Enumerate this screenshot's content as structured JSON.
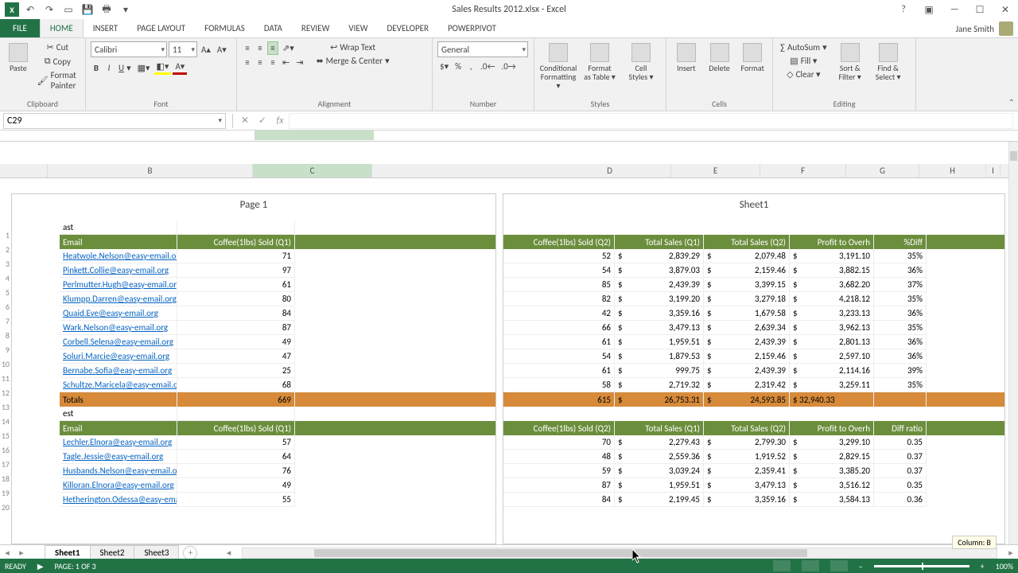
{
  "window": {
    "title": "Sales Results 2012.xlsx - Excel",
    "user": "Jane Smith"
  },
  "tabs": [
    "HOME",
    "INSERT",
    "PAGE LAYOUT",
    "FORMULAS",
    "DATA",
    "REVIEW",
    "VIEW",
    "DEVELOPER",
    "POWERPIVOT"
  ],
  "file_tab": "FILE",
  "ribbon": {
    "clipboard": {
      "paste": "Paste",
      "cut": "Cut",
      "copy": "Copy",
      "fmt": "Format Painter",
      "label": "Clipboard"
    },
    "font": {
      "name": "Calibri",
      "size": "11",
      "label": "Font"
    },
    "alignment": {
      "wrap": "Wrap Text",
      "merge": "Merge & Center",
      "label": "Alignment"
    },
    "number": {
      "format": "General",
      "label": "Number"
    },
    "styles": {
      "cond": "Conditional Formatting ▾",
      "table": "Format as Table ▾",
      "cell": "Cell Styles ▾",
      "label": "Styles"
    },
    "cells": {
      "insert": "Insert",
      "delete": "Delete",
      "format": "Format",
      "label": "Cells"
    },
    "editing": {
      "sum": "AutoSum",
      "fill": "Fill ▾",
      "clear": "Clear ▾",
      "sort": "Sort & Filter ▾",
      "find": "Find & Select ▾",
      "label": "Editing"
    }
  },
  "namebox": "C29",
  "columns_left": {
    "B": "B",
    "C": "C"
  },
  "columns_right": {
    "D": "D",
    "E": "E",
    "F": "F",
    "G": "G",
    "H": "H",
    "I": "I"
  },
  "pages": {
    "left_title": "Page 1",
    "right_title": "Sheet1"
  },
  "hdr1": {
    "frag": "ast",
    "email": "Email",
    "q1": "Coffee(1lbs) Sold (Q1)",
    "q2": "Coffee(1lbs) Sold (Q2)",
    "e": "Total Sales (Q1)",
    "f": "Total Sales (Q2)",
    "g": "Profit to Overh",
    "h": "%Diff"
  },
  "hdr2": {
    "frag": "est",
    "email": "Email",
    "q1": "Coffee(1lbs) Sold (Q1)",
    "q2": "Coffee(1lbs) Sold (Q2)",
    "e": "Total Sales (Q1)",
    "f": "Total Sales (Q2)",
    "g": "Profit to Overh",
    "h": "Diff ratio"
  },
  "block1": [
    {
      "email": "Heatwole.Nelson@easy-email.org",
      "q1": "71",
      "q2": "52",
      "e": "2,839.29",
      "f": "2,079.48",
      "g": "3,191.10",
      "h": "35%"
    },
    {
      "email": "Pinkett.Collie@easy-email.org",
      "q1": "97",
      "q2": "54",
      "e": "3,879.03",
      "f": "2,159.46",
      "g": "3,882.15",
      "h": "36%"
    },
    {
      "email": "Perlmutter.Hugh@easy-email.org",
      "q1": "61",
      "q2": "85",
      "e": "2,439.39",
      "f": "3,399.15",
      "g": "3,682.20",
      "h": "37%"
    },
    {
      "email": "Klumpp.Darren@easy-email.org",
      "q1": "80",
      "q2": "82",
      "e": "3,199.20",
      "f": "3,279.18",
      "g": "4,218.12",
      "h": "35%"
    },
    {
      "email": "Quaid.Eve@easy-email.org",
      "q1": "84",
      "q2": "42",
      "e": "3,359.16",
      "f": "1,679.58",
      "g": "3,233.13",
      "h": "36%"
    },
    {
      "email": "Wark.Nelson@easy-email.org",
      "q1": "87",
      "q2": "66",
      "e": "3,479.13",
      "f": "2,639.34",
      "g": "3,962.13",
      "h": "35%"
    },
    {
      "email": "Corbell.Selena@easy-email.org",
      "q1": "49",
      "q2": "61",
      "e": "1,959.51",
      "f": "2,439.39",
      "g": "2,801.13",
      "h": "36%"
    },
    {
      "email": "Soluri.Marcie@easy-email.org",
      "q1": "47",
      "q2": "54",
      "e": "1,879.53",
      "f": "2,159.46",
      "g": "2,597.10",
      "h": "36%"
    },
    {
      "email": "Bernabe.Sofia@easy-email.org",
      "q1": "25",
      "q2": "61",
      "e": "999.75",
      "f": "2,439.39",
      "g": "2,114.16",
      "h": "39%"
    },
    {
      "email": "Schultze.Maricela@easy-email.org",
      "q1": "68",
      "q2": "58",
      "e": "2,719.32",
      "f": "2,319.42",
      "g": "3,259.11",
      "h": "35%"
    }
  ],
  "totals1": {
    "label": "Totals",
    "q1": "669",
    "q2": "615",
    "e": "26,753.31",
    "f": "24,593.85",
    "g": "32,940.33"
  },
  "block2": [
    {
      "email": "Lechler.Elnora@easy-email.org",
      "q1": "57",
      "q2": "70",
      "e": "2,279.43",
      "f": "2,799.30",
      "g": "3,299.10",
      "h": "0.35"
    },
    {
      "email": "Tagle.Jessie@easy-email.org",
      "q1": "64",
      "q2": "48",
      "e": "2,559.36",
      "f": "1,919.52",
      "g": "2,829.15",
      "h": "0.37"
    },
    {
      "email": "Husbands.Nelson@easy-email.org",
      "q1": "76",
      "q2": "59",
      "e": "3,039.24",
      "f": "2,359.41",
      "g": "3,385.20",
      "h": "0.37"
    },
    {
      "email": "Killoran.Elnora@easy-email.org",
      "q1": "49",
      "q2": "87",
      "e": "1,959.51",
      "f": "3,479.13",
      "g": "3,516.12",
      "h": "0.35"
    },
    {
      "email": "Hetherington.Odessa@easy-email.org",
      "q1": "55",
      "q2": "84",
      "e": "2,199.45",
      "f": "3,359.16",
      "g": "3,584.13",
      "h": "0.36"
    }
  ],
  "rownums": [
    "1",
    "2",
    "3",
    "4",
    "5",
    "6",
    "7",
    "8",
    "9",
    "10",
    "11",
    "12",
    "13",
    "14",
    "15",
    "16",
    "17",
    "18",
    "19",
    "20"
  ],
  "sheets": [
    "Sheet1",
    "Sheet2",
    "Sheet3"
  ],
  "tooltip": "Column: B",
  "status": {
    "ready": "READY",
    "page": "PAGE: 1 OF 3",
    "zoom": "100%"
  }
}
